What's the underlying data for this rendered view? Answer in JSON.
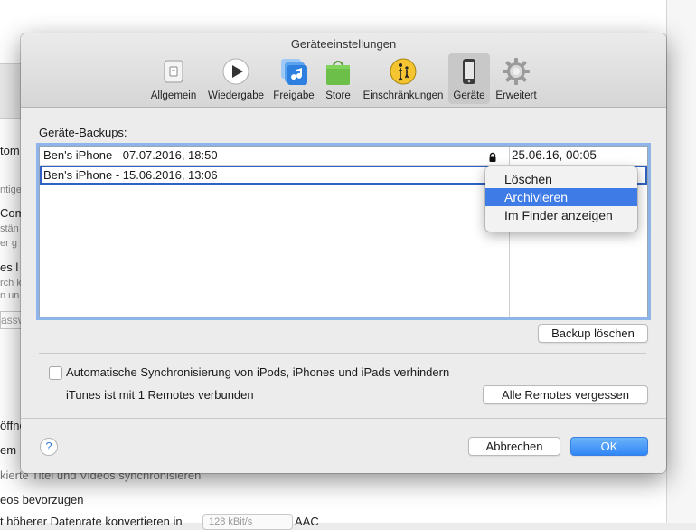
{
  "background": {
    "fragments": [
      "tom",
      "ntige",
      "Com",
      "stän",
      "er g",
      "es l",
      "rch k",
      "n un",
      "assv",
      "öffne",
      "em",
      "kierte Titel und Videos synchronisieren",
      "eos bevorzugen",
      "t höherer Datenrate konvertieren in",
      "AAC"
    ],
    "bitrate_select": "128 kBit/s"
  },
  "dialog": {
    "title": "Geräteeinstellungen",
    "tabs": [
      {
        "label": "Allgemein",
        "icon": "switch-icon"
      },
      {
        "label": "Wiedergabe",
        "icon": "play-icon"
      },
      {
        "label": "Freigabe",
        "icon": "sharing-music-icon"
      },
      {
        "label": "Store",
        "icon": "store-bag-icon"
      },
      {
        "label": "Einschränkungen",
        "icon": "parental-icon"
      },
      {
        "label": "Geräte",
        "icon": "iphone-icon",
        "active": true
      },
      {
        "label": "Erweitert",
        "icon": "gear-icon"
      }
    ],
    "backups_label": "Geräte-Backups:",
    "backups": [
      {
        "name": "Ben's iPhone - 07.07.2016, 18:50",
        "date": "25.06.16, 00:05",
        "locked": true
      },
      {
        "name": "Ben's iPhone - 15.06.2016, 13:06",
        "date": "",
        "locked": false,
        "selected": true
      }
    ],
    "context_menu": {
      "items": [
        "Löschen",
        "Archivieren",
        "Im Finder anzeigen"
      ],
      "highlighted": "Archivieren"
    },
    "delete_backup_button": "Backup löschen",
    "prevent_sync_label": "Automatische Synchronisierung von iPods, iPhones und iPads verhindern",
    "prevent_sync_checked": false,
    "remotes_label": "iTunes ist mit 1 Remotes verbunden",
    "forget_remotes_button": "Alle Remotes vergessen",
    "help_label": "?",
    "cancel_button": "Abbrechen",
    "ok_button": "OK"
  },
  "colors": {
    "accent": "#3e7be6",
    "selection_border": "#2f62c4",
    "focus_ring": "#8fb4ea"
  }
}
